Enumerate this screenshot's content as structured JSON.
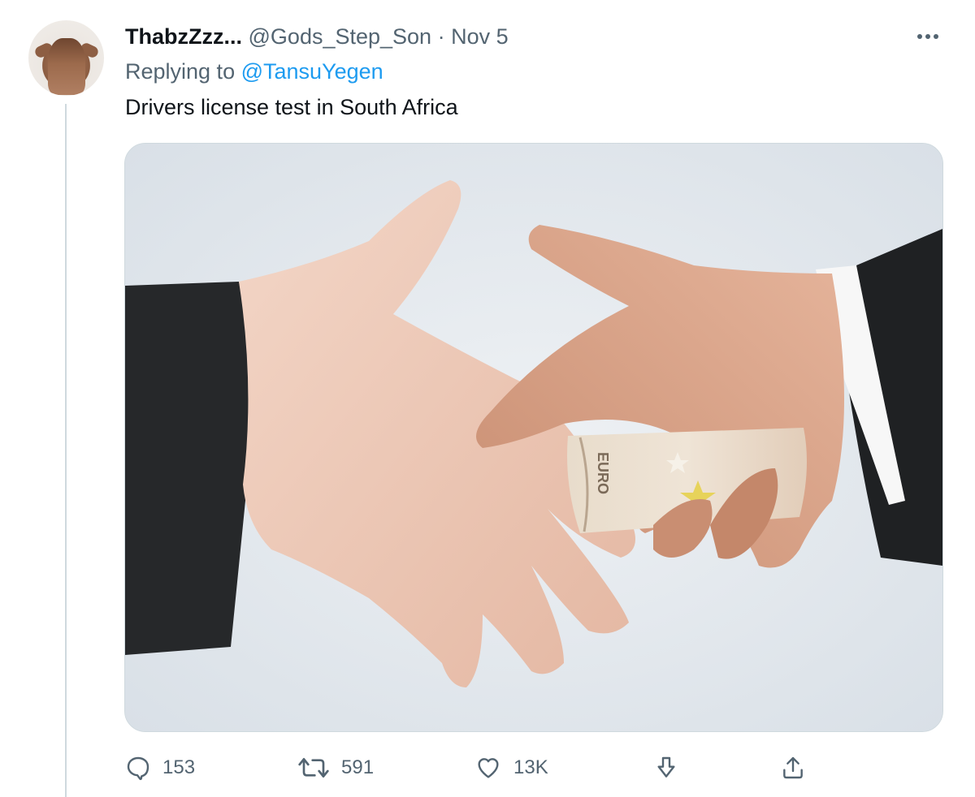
{
  "tweet": {
    "display_name": "ThabzZzz...",
    "handle": "@Gods_Step_Son",
    "separator": "·",
    "date": "Nov 5",
    "replying_to_label": "Replying to",
    "replying_to_user": "@TansuYegen",
    "text": "Drivers license test in South Africa",
    "media_description_icon": "photo-handshake-bribe"
  },
  "actions": {
    "reply_count": "153",
    "retweet_count": "591",
    "like_count": "13K"
  },
  "icons": {
    "more": "more-horizontal-icon",
    "reply": "reply-bubble-icon",
    "retweet": "retweet-icon",
    "like": "heart-icon",
    "downvote": "downvote-arrow-icon",
    "share": "share-icon"
  },
  "colors": {
    "text_primary": "#0f1419",
    "text_secondary": "#536471",
    "link": "#1d9bf0",
    "border": "#cfd9de"
  }
}
